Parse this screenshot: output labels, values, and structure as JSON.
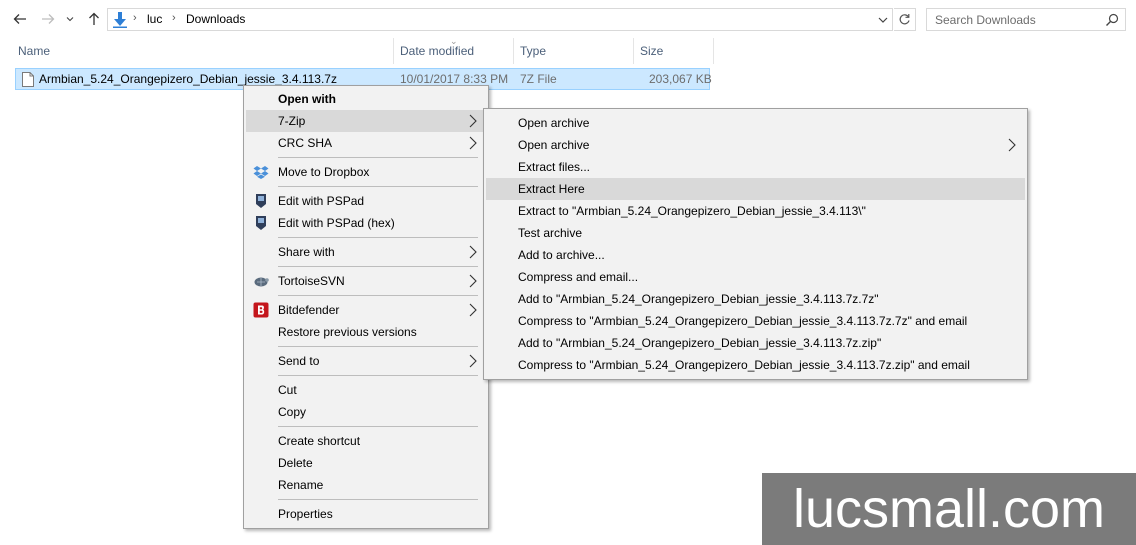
{
  "nav": {
    "back_icon": "arrow-left-icon",
    "forward_icon": "arrow-right-icon",
    "recent_icon": "chevron-down-icon",
    "up_icon": "arrow-up-icon"
  },
  "address": {
    "crumbs": [
      "luc",
      "Downloads"
    ],
    "separator": "›"
  },
  "search": {
    "placeholder": "Search Downloads"
  },
  "columns": {
    "name": "Name",
    "date": "Date modified",
    "type": "Type",
    "size": "Size"
  },
  "file": {
    "name": "Armbian_5.24_Orangepizero_Debian_jessie_3.4.113.7z",
    "date": "10/01/2017 8:33 PM",
    "type": "7Z File",
    "size": "203,067 KB"
  },
  "context_menu": {
    "open_with": "Open with",
    "seven_zip": "7-Zip",
    "crc_sha": "CRC SHA",
    "move_to_dropbox": "Move to Dropbox",
    "edit_pspad": "Edit with PSPad",
    "edit_pspad_hex": "Edit with PSPad (hex)",
    "share_with": "Share with",
    "tortoisesvn": "TortoiseSVN",
    "bitdefender": "Bitdefender",
    "restore_versions": "Restore previous versions",
    "send_to": "Send to",
    "cut": "Cut",
    "copy": "Copy",
    "create_shortcut": "Create shortcut",
    "delete": "Delete",
    "rename": "Rename",
    "properties": "Properties"
  },
  "submenu": {
    "items": [
      "Open archive",
      "Open archive",
      "Extract files...",
      "Extract Here",
      "Extract to \"Armbian_5.24_Orangepizero_Debian_jessie_3.4.113\\\"",
      "Test archive",
      "Add to archive...",
      "Compress and email...",
      "Add to \"Armbian_5.24_Orangepizero_Debian_jessie_3.4.113.7z.7z\"",
      "Compress to \"Armbian_5.24_Orangepizero_Debian_jessie_3.4.113.7z.7z\" and email",
      "Add to \"Armbian_5.24_Orangepizero_Debian_jessie_3.4.113.7z.zip\"",
      "Compress to \"Armbian_5.24_Orangepizero_Debian_jessie_3.4.113.7z.zip\" and email"
    ],
    "highlighted": "Extract Here"
  },
  "watermark": {
    "text": "lucsmall.com"
  },
  "colors": {
    "selection": "#cce8ff",
    "selection_border": "#99d1ff",
    "menu_bg": "#f2f2f2",
    "menu_hover": "#d9d9d9",
    "header_text": "#4c607a",
    "watermark_bg": "#7b7b7b",
    "bitdefender_red": "#c4161c"
  }
}
